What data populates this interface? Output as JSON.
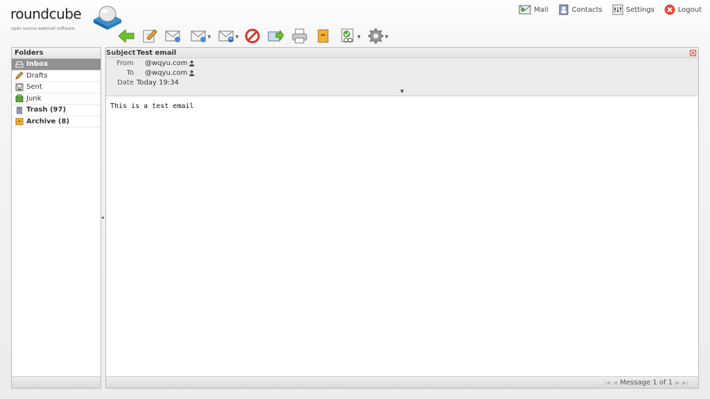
{
  "logo": {
    "word": "roundcube",
    "tagline": "open source webmail software"
  },
  "topnav": [
    {
      "label": "Mail",
      "icon": "mail-icon"
    },
    {
      "label": "Contacts",
      "icon": "contacts-icon"
    },
    {
      "label": "Settings",
      "icon": "settings-icon"
    },
    {
      "label": "Logout",
      "icon": "logout-icon"
    }
  ],
  "toolbar": [
    {
      "icon": "back-arrow-icon"
    },
    {
      "icon": "compose-icon"
    },
    {
      "icon": "reply-icon"
    },
    {
      "icon": "reply-all-icon",
      "dropdown": true
    },
    {
      "icon": "forward-icon",
      "dropdown": true
    },
    {
      "icon": "delete-icon"
    },
    {
      "icon": "move-icon"
    },
    {
      "icon": "print-icon"
    },
    {
      "icon": "archive-icon"
    },
    {
      "icon": "mark-icon",
      "dropdown": true
    },
    {
      "icon": "more-gear-icon",
      "dropdown": true
    }
  ],
  "folders": {
    "title": "Folders",
    "items": [
      {
        "label": "Inbox",
        "icon": "inbox-icon",
        "selected": true
      },
      {
        "label": "Drafts",
        "icon": "drafts-icon"
      },
      {
        "label": "Sent",
        "icon": "sent-icon"
      },
      {
        "label": "Junk",
        "icon": "junk-icon"
      },
      {
        "label": "Trash (97)",
        "icon": "trash-icon",
        "bold": true
      },
      {
        "label": "Archive (8)",
        "icon": "archive-folder-icon",
        "bold": true
      }
    ]
  },
  "message": {
    "subject_label": "Subject",
    "subject": "Test email",
    "from_label": "From",
    "from": "@wqyu.com",
    "to_label": "To",
    "to": "@wqyu.com",
    "date_label": "Date",
    "date": "Today 19:34",
    "body": "This is a test email"
  },
  "pager": {
    "text": "Message 1 of 1"
  },
  "colors": {
    "selected_folder": "#919191",
    "delete_red": "#d9332a",
    "back_green": "#6cbf2c",
    "logout_red": "#e24a3a"
  }
}
